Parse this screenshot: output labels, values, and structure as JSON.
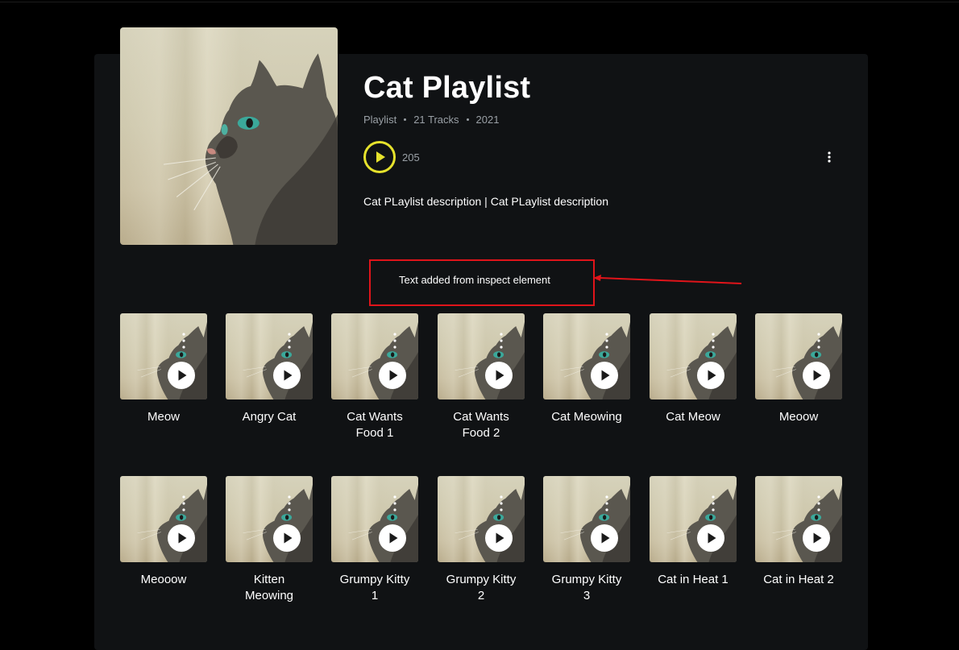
{
  "playlist": {
    "title": "Cat Playlist",
    "type": "Playlist",
    "tracks": "21 Tracks",
    "year": "2021",
    "likes": "205",
    "description": "Cat PLaylist description | Cat PLaylist description"
  },
  "annotation": {
    "text": "Text added from inspect element",
    "color": "#e0141a"
  },
  "colors": {
    "accent": "#e6e22c",
    "panel": "#101214",
    "background": "#000000"
  },
  "tracks": [
    {
      "name": "Meow"
    },
    {
      "name": "Angry Cat"
    },
    {
      "name": "Cat Wants Food 1"
    },
    {
      "name": "Cat Wants Food 2"
    },
    {
      "name": "Cat Meowing"
    },
    {
      "name": "Cat Meow"
    },
    {
      "name": "Meoow"
    },
    {
      "name": "Meooow"
    },
    {
      "name": "Kitten Meowing"
    },
    {
      "name": "Grumpy Kitty 1"
    },
    {
      "name": "Grumpy Kitty 2"
    },
    {
      "name": "Grumpy Kitty 3"
    },
    {
      "name": "Cat in Heat 1"
    },
    {
      "name": "Cat in Heat 2"
    }
  ],
  "icons": {
    "main_play": "play-icon",
    "more": "more-vertical-icon",
    "tile_play": "play-icon"
  }
}
